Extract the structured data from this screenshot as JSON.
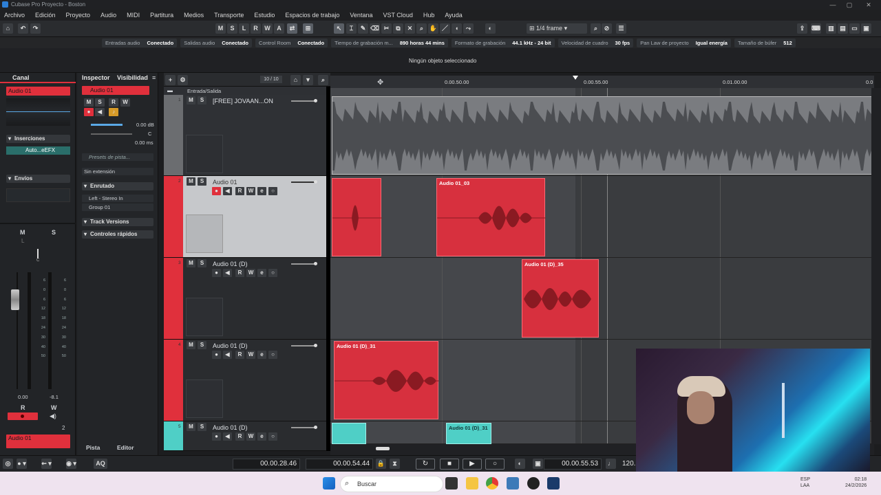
{
  "title": "Cubase Pro Proyecto - Boston",
  "menu": [
    "Archivo",
    "Edición",
    "Proyecto",
    "Audio",
    "MIDI",
    "Partitura",
    "Medios",
    "Transporte",
    "Estudio",
    "Espacios de trabajo",
    "Ventana",
    "VST Cloud",
    "Hub",
    "Ayuda"
  ],
  "toolbar": {
    "m": "M",
    "s": "S",
    "l": "L",
    "r": "R",
    "w": "W",
    "a": "A",
    "grid_label": "1/4 frame"
  },
  "status": [
    {
      "label": "Entradas audio",
      "value": "Conectado"
    },
    {
      "label": "Salidas audio",
      "value": "Conectado"
    },
    {
      "label": "Control Room",
      "value": "Conectado"
    },
    {
      "label": "Tiempo de grabación m...",
      "value": "890 horas 44 mins"
    },
    {
      "label": "Formato de grabación",
      "value": "44.1 kHz - 24 bit"
    },
    {
      "label": "Velocidad de cuadro",
      "value": "30 fps"
    },
    {
      "label": "Pan Law de proyecto",
      "value": "Igual energía"
    },
    {
      "label": "Tamaño de búfer",
      "value": "512"
    }
  ],
  "info": "Ningún objeto seleccionado",
  "left": {
    "tab": "Canal",
    "channel": "Audio 01",
    "inserts": "Inserciones",
    "insert_plugin": "Auto...eEFX",
    "sends": "Envíos",
    "m": "M",
    "s": "S",
    "l": "L",
    "vol_left": "0.00",
    "vol_right": "-8.1",
    "r": "R",
    "w": "W",
    "bottom_name": "Audio 01",
    "pan": "C",
    "num": "2",
    "scale": [
      "6",
      "0",
      "6",
      "12",
      "18",
      "24",
      "30",
      "40",
      "50"
    ]
  },
  "inspector": {
    "tab1": "Inspector",
    "tab2": "Visibilidad",
    "track": "Audio 01",
    "vol": "0.00 dB",
    "pan": "C",
    "delay": "0.00 ms",
    "presets": "Presets de pista...",
    "ext": "Sin extensión",
    "routing": "Enrutado",
    "input": "Left - Stereo In",
    "output": "Group 01",
    "versions": "Track Versions",
    "quick": "Controles rápidos"
  },
  "trackheader": {
    "counter": "10 / 10",
    "folder": "Entrada/Salida"
  },
  "tracks": [
    {
      "num": "1",
      "name": "[FREE] JOVAAN...ON",
      "color": "#6b6d70"
    },
    {
      "num": "2",
      "name": "Audio 01",
      "color": "#e0303c"
    },
    {
      "num": "3",
      "name": "Audio 01 (D)",
      "color": "#e0303c"
    },
    {
      "num": "4",
      "name": "Audio 01 (D)",
      "color": "#e0303c"
    },
    {
      "num": "5",
      "name": "Audio 01 (D)",
      "color": "#4fcfc6"
    }
  ],
  "ruler": [
    "0.00.50.00",
    "0.00.55.00",
    "0.01.00.00",
    "0.0"
  ],
  "clips": {
    "c1": "Audio 01_03",
    "c2": "Audio 01 (D)_35",
    "c3": "Audio 01 (D)_31",
    "c4": "Audio 01 (D)_31"
  },
  "bottom_tabs": {
    "pista": "Pista",
    "editor": "Editor"
  },
  "transport": {
    "aq": "AQ",
    "left": "00.00.28.46",
    "right": "00.00.54.44",
    "pos": "00.00.55.53",
    "tempo": "120."
  },
  "taskbar": {
    "search": "Buscar",
    "lang1": "ESP",
    "lang2": "LAA",
    "time": "02:18",
    "date": "24/2/2026"
  }
}
